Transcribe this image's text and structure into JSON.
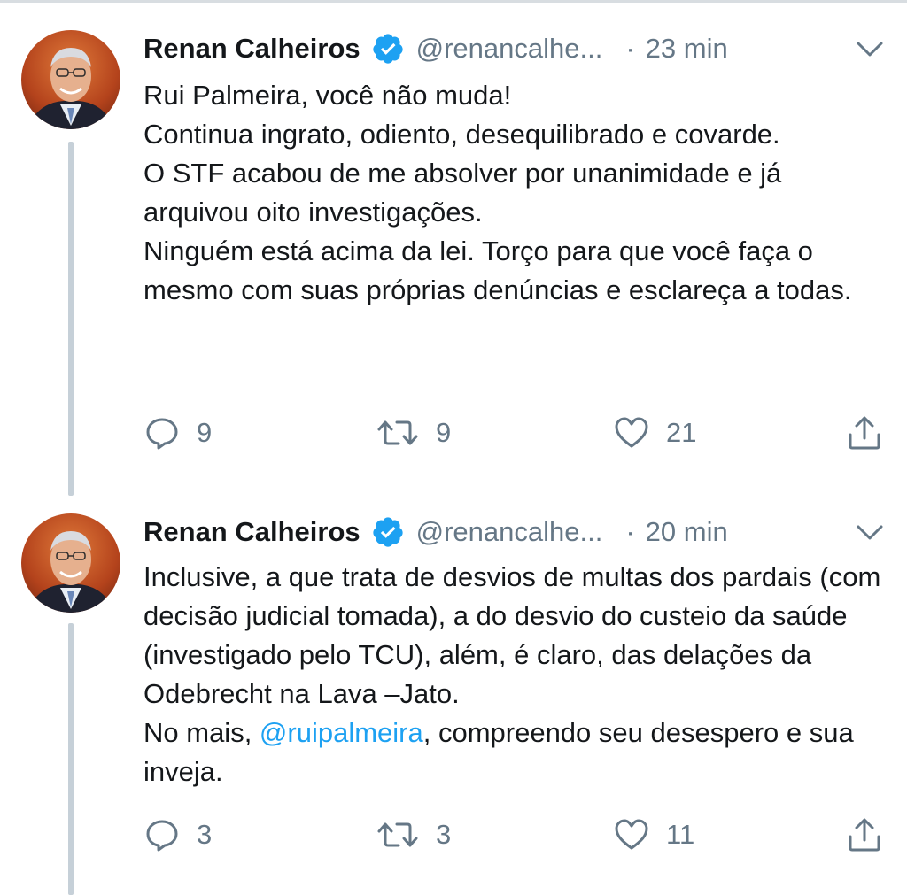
{
  "colors": {
    "link": "#1da1f2",
    "secondary": "#657786",
    "text": "#14171a",
    "verified": "#1da1f2"
  },
  "tweets": [
    {
      "name": "Renan Calheiros",
      "handle": "@renancalhe...",
      "separator": "·",
      "time": "23 min",
      "text": "Rui Palmeira, você não muda!\nContinua ingrato, odiento, desequilibrado e covarde.\nO STF acabou de me absolver por unanimidade e já arquivou oito investigações.\nNinguém está acima da lei. Torço para que você faça o mesmo com suas próprias denúncias e esclareça a todas.",
      "replies": "9",
      "retweets": "9",
      "likes": "21"
    },
    {
      "name": "Renan Calheiros",
      "handle": "@renancalhe...",
      "separator": "·",
      "time": "20 min",
      "text_before": "Inclusive, a que trata de desvios de multas dos pardais (com decisão judicial tomada), a do desvio do custeio da saúde (investigado pelo TCU), além, é claro, das delações da Odebrecht na Lava –Jato.\nNo mais, ",
      "mention": "@ruipalmeira",
      "text_after": ", compreendo seu desespero e sua inveja.",
      "replies": "3",
      "retweets": "3",
      "likes": "11"
    }
  ]
}
